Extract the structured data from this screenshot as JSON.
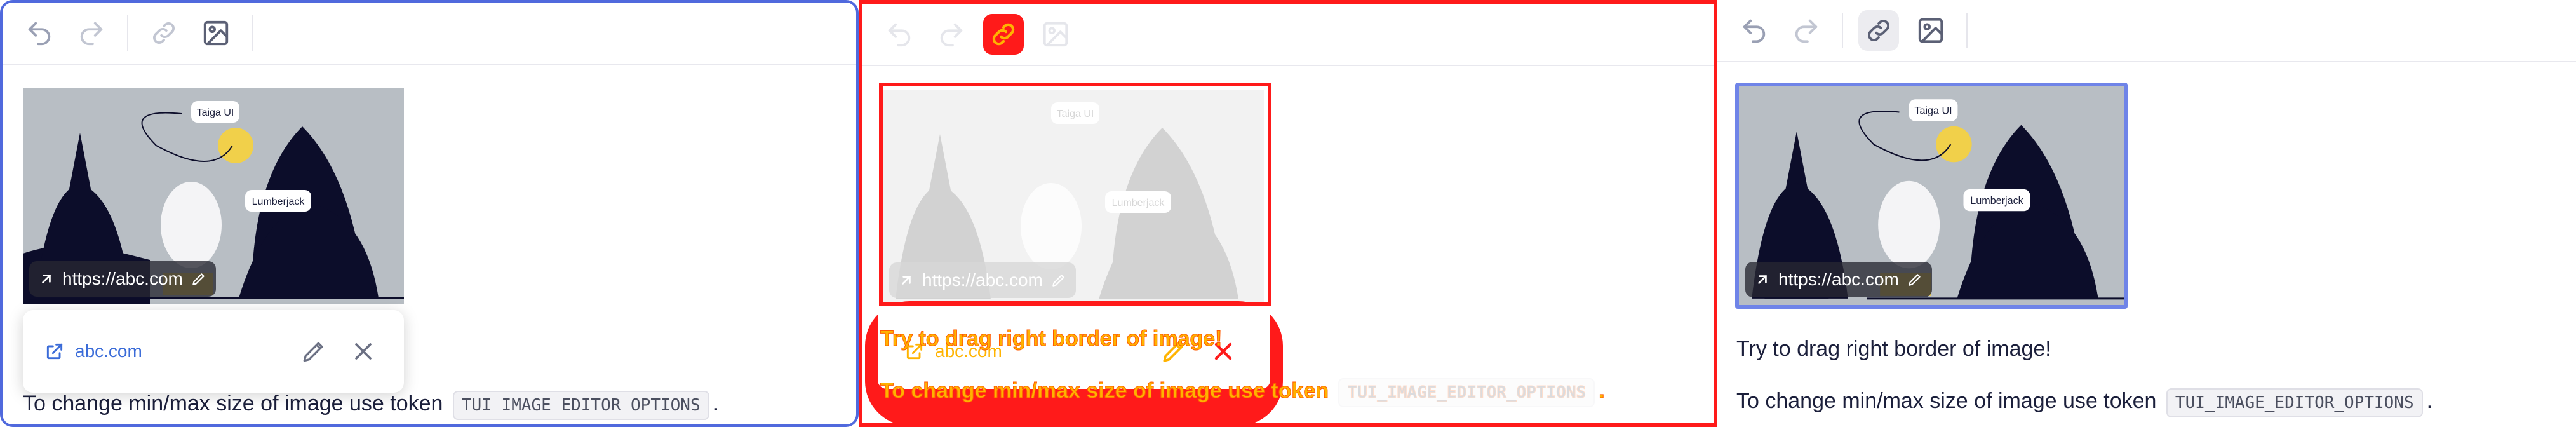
{
  "image": {
    "labels": [
      "Taiga UI",
      "Lumberjack"
    ],
    "url": "https://abc.com"
  },
  "popup": {
    "link_text": "abc.com"
  },
  "text": {
    "line1": "Try to drag right border of image!",
    "line2_prefix": "To change min/max size of image use token",
    "token": "TUI_IMAGE_EDITOR_OPTIONS",
    "line2_suffix": "."
  },
  "icons": {
    "undo": "undo-icon",
    "redo": "redo-icon",
    "link": "link-icon",
    "image": "image-icon",
    "external": "external-link-icon",
    "edit": "pencil-icon",
    "close": "close-icon"
  },
  "colors": {
    "accent_blue": "#5069dd",
    "highlight_red": "#ff1a1a",
    "link": "#3a6bd8"
  }
}
